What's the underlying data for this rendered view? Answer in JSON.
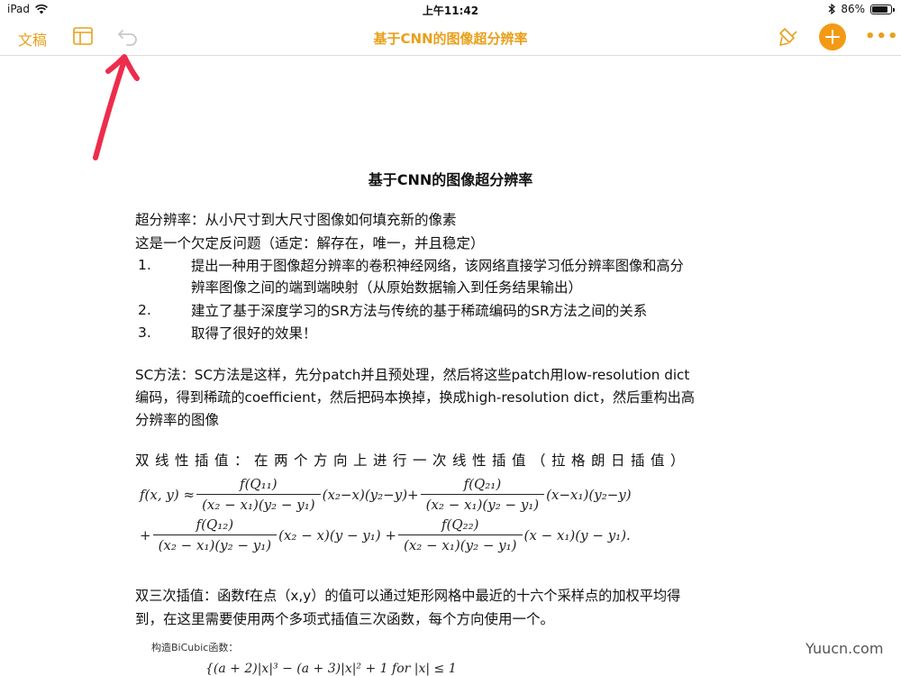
{
  "status_bar": {
    "device": "iPad",
    "time": "上午11:42",
    "battery_percent_label": "86%",
    "battery_level": 0.86
  },
  "toolbar": {
    "docs_label": "文稿",
    "title": "基于CNN的图像超分辨率",
    "more_label": "•••",
    "accent_color": "#e9a01b"
  },
  "document": {
    "title": "基于CNN的图像超分辨率",
    "intro_lines": [
      "超分辨率：从小尺寸到大尺寸图像如何填充新的像素",
      "这是一个欠定反问题（适定：解存在，唯一，并且稳定）"
    ],
    "list": [
      {
        "num": "1.",
        "line1": "提出一种用于图像超分辨率的卷积神经网络，该网络直接学习低分辨率图像和高分",
        "line2": "辨率图像之间的端到端映射（从原始数据输入到任务结果输出）"
      },
      {
        "num": "2.",
        "line1": "建立了基于深度学习的SR方法与传统的基于稀疏编码的SR方法之间的关系"
      },
      {
        "num": "3.",
        "line1": "取得了很好的效果！"
      }
    ],
    "sc_lines": [
      "SC方法：SC方法是这样，先分patch并且预处理，然后将这些patch用low-resolution  dict",
      "编码，得到稀疏的coefficient，然后把码本换掉，换成high-resolution  dict，然后重构出高",
      "分辨率的图像"
    ],
    "bilinear_heading": "双线性插值：在两个方向上进行一次线性插值（拉格朗日插值）",
    "bicubic_lines": [
      "双三次插值：函数f在点（x,y）的值可以通过矩形网格中最近的十六个采样点的加权平均得",
      "到，在这里需要使用两个多项式插值三次函数，每个方向使用一个。"
    ],
    "bicubic_caption": "构造BiCubic函数：",
    "formula": {
      "lhs": "f(x, y) ≈",
      "t1_num": "f(Q₁₁)",
      "t1_den": "(x₂ − x₁)(y₂ − y₁)",
      "t1_tail": "(x₂−x)(y₂−y)+",
      "t2_num": "f(Q₂₁)",
      "t2_den": "(x₂ − x₁)(y₂ − y₁)",
      "t2_tail": "(x−x₁)(y₂−y)",
      "row2_lead": "+",
      "t3_num": "f(Q₁₂)",
      "t3_den": "(x₂ − x₁)(y₂ − y₁)",
      "t3_tail": "(x₂ − x)(y − y₁) +",
      "t4_num": "f(Q₂₂)",
      "t4_den": "(x₂ − x₁)(y₂ − y₁)",
      "t4_tail": "(x − x₁)(y − y₁)."
    },
    "cases_line": "{(a + 2)|x|³ − (a + 3)|x|² + 1    for |x| ≤ 1"
  },
  "watermark": "Yuucn.com"
}
